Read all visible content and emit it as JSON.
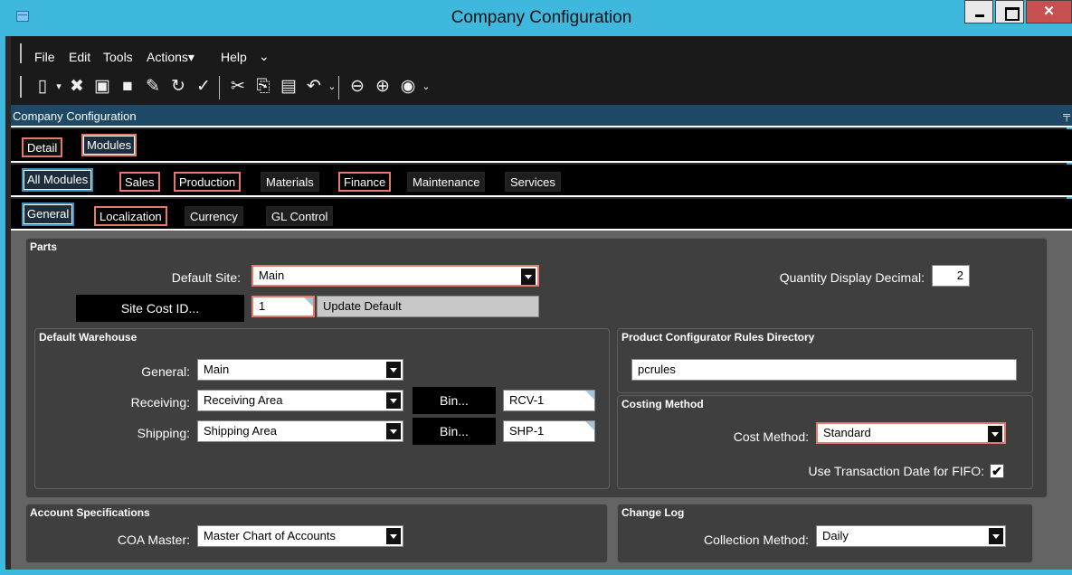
{
  "window": {
    "title": "Company Configuration"
  },
  "menu": {
    "items": [
      "File",
      "Edit",
      "Tools",
      "Actions▾",
      "Help"
    ]
  },
  "toolbar": {
    "icons": [
      "new-icon",
      "delete-icon",
      "save-icon",
      "stop-icon",
      "edit-icon",
      "refresh-icon",
      "clear-icon",
      "cut-icon",
      "copy-icon",
      "paste-icon",
      "undo-icon",
      "back-icon",
      "forward-icon",
      "home-icon"
    ]
  },
  "panel": {
    "title": "Company Configuration"
  },
  "tabs_top": [
    "Detail",
    "Modules"
  ],
  "tabs_modules": [
    "All Modules",
    "Sales",
    "Production",
    "Materials",
    "Finance",
    "Maintenance",
    "Services"
  ],
  "tabs_sub": [
    "General",
    "Localization",
    "Currency",
    "GL Control"
  ],
  "parts": {
    "title": "Parts",
    "default_site_label": "Default Site:",
    "default_site_value": "Main",
    "site_cost_id_button": "Site Cost ID...",
    "site_cost_id_value": "1",
    "update_default_label": "Update Default",
    "qty_decimal_label": "Quantity Display Decimal:",
    "qty_decimal_value": "2"
  },
  "warehouse": {
    "title": "Default Warehouse",
    "general_label": "General:",
    "general_value": "Main",
    "receiving_label": "Receiving:",
    "receiving_value": "Receiving Area",
    "receiving_bin_button": "Bin...",
    "receiving_bin_value": "RCV-1",
    "shipping_label": "Shipping:",
    "shipping_value": "Shipping Area",
    "shipping_bin_button": "Bin...",
    "shipping_bin_value": "SHP-1"
  },
  "product_config": {
    "title": "Product Configurator Rules Directory",
    "value": "pcrules"
  },
  "costing": {
    "title": "Costing Method",
    "cost_method_label": "Cost Method:",
    "cost_method_value": "Standard",
    "fifo_label": "Use Transaction Date for FIFO:",
    "fifo_checked": true,
    "check_glyph": "✔"
  },
  "account_specs": {
    "title": "Account Specifications",
    "coa_label": "COA Master:",
    "coa_value": "Master Chart of Accounts"
  },
  "change_log": {
    "title": "Change Log",
    "collection_label": "Collection Method:",
    "collection_value": "Daily"
  }
}
